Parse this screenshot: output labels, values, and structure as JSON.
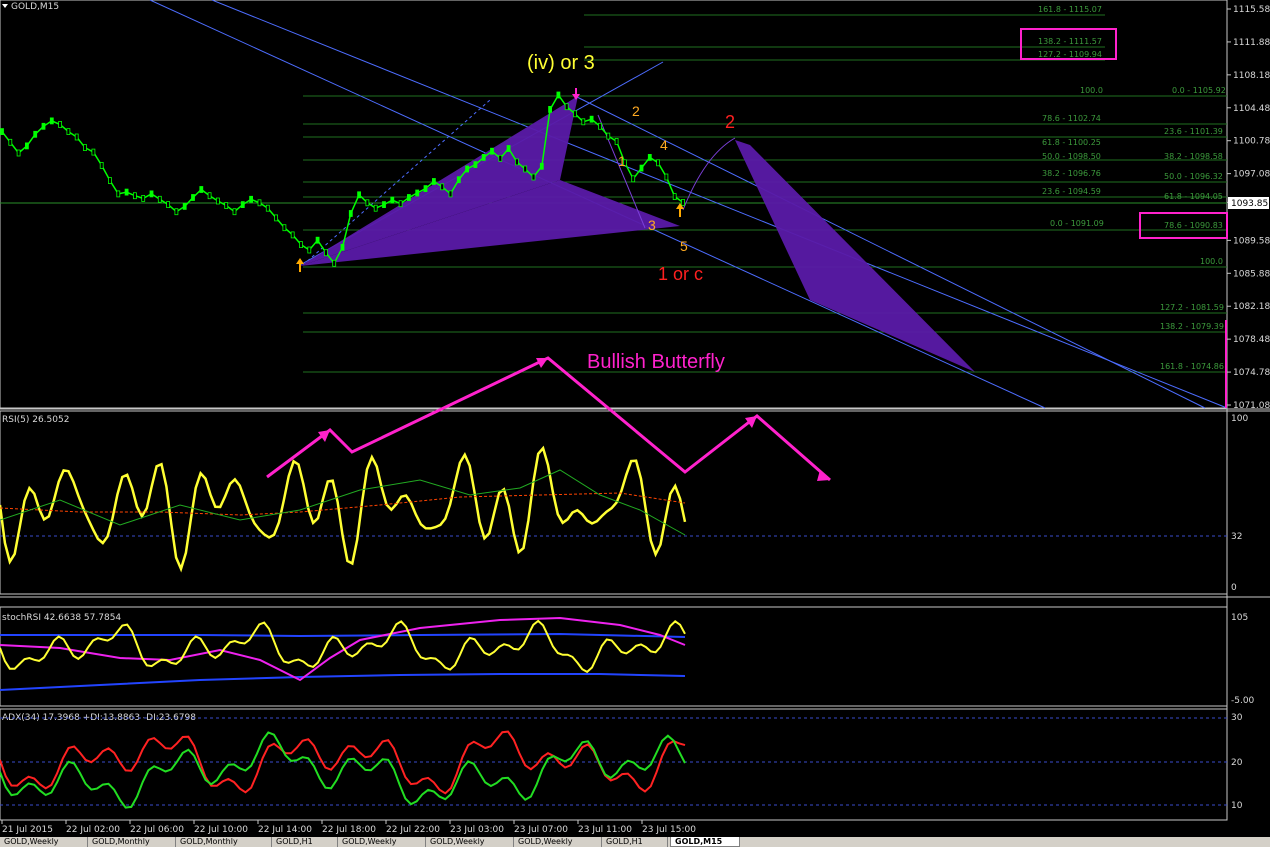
{
  "window": {
    "symbol_title": "GOLD,M15"
  },
  "price_axis": {
    "ticks": [
      "1115.58",
      "1111.88",
      "1108.18",
      "1104.48",
      "1100.78",
      "1097.08",
      "1093.85",
      "1089.58",
      "1085.88",
      "1082.18",
      "1078.48",
      "1074.78",
      "1071.08"
    ],
    "current_price": "1093.85"
  },
  "fib_levels": [
    {
      "label": "161.8 - 1115.07"
    },
    {
      "label": "138.2 - 1111.57"
    },
    {
      "label": "127.2 - 1109.94"
    },
    {
      "label": "100.0"
    },
    {
      "label": "0.0 - 1105.92"
    },
    {
      "label": "78.6 - 1102.74"
    },
    {
      "label": "23.6 - 1101.39"
    },
    {
      "label": "61.8 - 1100.25"
    },
    {
      "label": "50.0 - 1098.50"
    },
    {
      "label": "38.2 - 1098.58"
    },
    {
      "label": "38.2 - 1096.76"
    },
    {
      "label": "50.0 - 1096.32"
    },
    {
      "label": "23.6 - 1094.59"
    },
    {
      "label": "61.8 - 1094.05"
    },
    {
      "label": "0.0 - 1091.09"
    },
    {
      "label": "78.6 - 1090.83"
    },
    {
      "label": "100.0"
    },
    {
      "label": "127.2 - 1081.59"
    },
    {
      "label": "138.2 - 1079.39"
    },
    {
      "label": "161.8 - 1074.86"
    }
  ],
  "annotations": {
    "wave_iv": "(iv) or 3",
    "wave_2_small": "2",
    "wave_1_small": "1",
    "wave_4_small": "4",
    "wave_3_small": "3",
    "wave_5_small": "5",
    "wave_2_red": "2",
    "wave_1c": "1 or c",
    "pattern": "Bullish Butterfly"
  },
  "indicators": {
    "rsi": {
      "title": "RSI(5) 26.5052",
      "ticks": [
        "100",
        "32",
        "0"
      ]
    },
    "stoch": {
      "title": "stochRSI 42.6638 57.7854",
      "ticks": [
        "105",
        "-5.00"
      ]
    },
    "adx": {
      "title": "ADX(34) 17.3968 +DI:13.8863 -DI:23.6798",
      "ticks": [
        "30",
        "20",
        "10"
      ]
    }
  },
  "time_axis": [
    "21 Jul 2015",
    "22 Jul 02:00",
    "22 Jul 06:00",
    "22 Jul 10:00",
    "22 Jul 14:00",
    "22 Jul 18:00",
    "22 Jul 22:00",
    "23 Jul 03:00",
    "23 Jul 07:00",
    "23 Jul 11:00",
    "23 Jul 15:00"
  ],
  "tabs": [
    "GOLD,Weekly",
    "GOLD,Monthly",
    "GOLD,Monthly",
    "GOLD,H1",
    "GOLD,Weekly",
    "GOLD,Weekly",
    "GOLD,Weekly",
    "GOLD,H1",
    "GOLD,M15"
  ],
  "colors": {
    "background": "#000000",
    "up_candle": "#00ff00",
    "butterfly_fill": "#5a1aa8",
    "trend_line": "#4d6dff",
    "fib_line": "#1f6f1f",
    "magenta": "#ff22cc",
    "rsi_line": "#ffff33",
    "plus_di": "#22dd22",
    "minus_di": "#ff2222"
  },
  "chart_data": {
    "type": "line",
    "title": "GOLD,M15",
    "x_labels": [
      "21 Jul 2015",
      "22 Jul 02:00",
      "22 Jul 06:00",
      "22 Jul 10:00",
      "22 Jul 14:00",
      "22 Jul 18:00",
      "22 Jul 22:00",
      "23 Jul 03:00",
      "23 Jul 07:00",
      "23 Jul 11:00",
      "23 Jul 15:00"
    ],
    "ylim": [
      1071.08,
      1115.58
    ],
    "series": [
      {
        "values": [
          1101.8,
          1100.6,
          1099.4,
          1100.2,
          1101.5,
          1102.4,
          1103.0,
          1102.6,
          1101.8,
          1101.2,
          1100.0,
          1099.5,
          1098.0,
          1096.3,
          1094.8,
          1095.0,
          1094.6,
          1094.3,
          1094.8,
          1094.2,
          1093.6,
          1092.8,
          1093.4,
          1094.4,
          1095.3,
          1094.6,
          1094.0,
          1093.5,
          1092.8,
          1093.6,
          1094.2,
          1093.8,
          1093.2,
          1092.1,
          1091.0,
          1090.2,
          1089.1,
          1088.5,
          1089.6,
          1088.2,
          1087.0,
          1088.8,
          1092.6,
          1094.7,
          1093.8,
          1093.2,
          1093.6,
          1094.1,
          1093.7,
          1094.4,
          1094.9,
          1095.4,
          1096.2,
          1095.6,
          1094.8,
          1096.4,
          1097.6,
          1098.1,
          1098.9,
          1099.6,
          1098.8,
          1099.9,
          1098.4,
          1097.6,
          1096.7,
          1097.9,
          1104.3,
          1105.92,
          1104.6,
          1103.8,
          1102.9,
          1103.2,
          1102.4,
          1101.3,
          1100.7,
          1098.3,
          1096.5,
          1097.7,
          1098.9,
          1098.3,
          1096.7,
          1094.5,
          1093.85
        ]
      }
    ]
  }
}
